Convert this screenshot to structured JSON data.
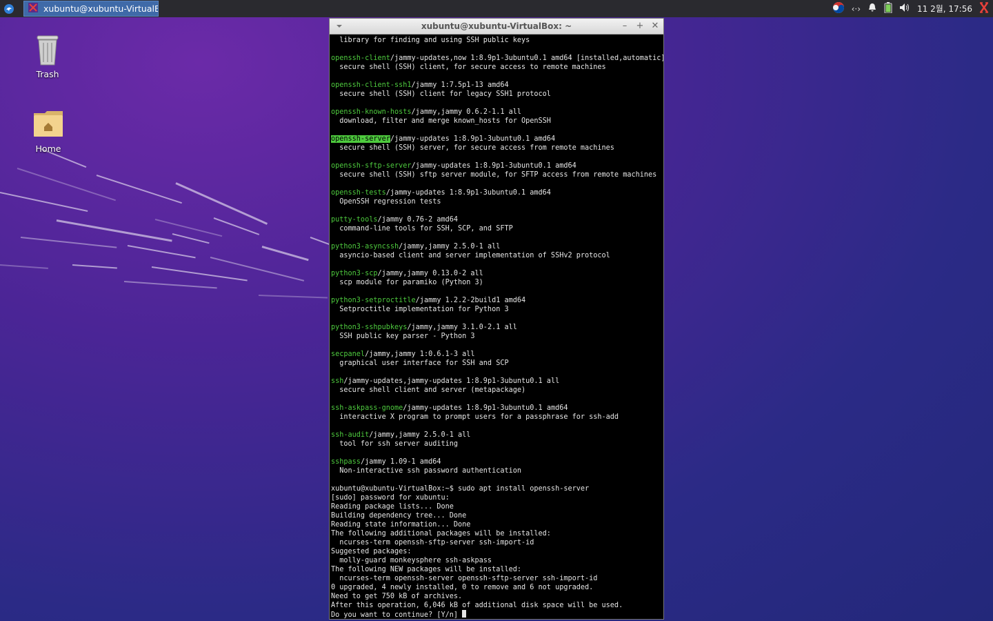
{
  "panel": {
    "task_title": "xubuntu@xubuntu-VirtualBo...",
    "clock": "11 2월, 17:56",
    "tray_icons": [
      "ibus-korean-icon",
      "network-icon",
      "notification-bell-icon",
      "battery-icon",
      "volume-icon",
      "xfce-logo-icon"
    ]
  },
  "desktop": {
    "trash_label": "Trash",
    "home_label": "Home"
  },
  "terminal": {
    "title": "xubuntu@xubuntu-VirtualBox: ~",
    "entries": [
      {
        "pkg": "",
        "rest": "",
        "desc": "  library for finding and using SSH public keys"
      },
      {
        "pkg": "openssh-client",
        "rest": "/jammy-updates,now 1:8.9p1-3ubuntu0.1 amd64 [installed,automatic]",
        "desc": "  secure shell (SSH) client, for secure access to remote machines"
      },
      {
        "pkg": "openssh-client-ssh1",
        "rest": "/jammy 1:7.5p1-13 amd64",
        "desc": "  secure shell (SSH) client for legacy SSH1 protocol"
      },
      {
        "pkg": "openssh-known-hosts",
        "rest": "/jammy,jammy 0.6.2-1.1 all",
        "desc": "  download, filter and merge known_hosts for OpenSSH"
      },
      {
        "pkg": "openssh-server",
        "rest": "/jammy-updates 1:8.9p1-3ubuntu0.1 amd64",
        "desc": "  secure shell (SSH) server, for secure access from remote machines",
        "highlight": true
      },
      {
        "pkg": "openssh-sftp-server",
        "rest": "/jammy-updates 1:8.9p1-3ubuntu0.1 amd64",
        "desc": "  secure shell (SSH) sftp server module, for SFTP access from remote machines"
      },
      {
        "pkg": "openssh-tests",
        "rest": "/jammy-updates 1:8.9p1-3ubuntu0.1 amd64",
        "desc": "  OpenSSH regression tests"
      },
      {
        "pkg": "putty-tools",
        "rest": "/jammy 0.76-2 amd64",
        "desc": "  command-line tools for SSH, SCP, and SFTP"
      },
      {
        "pkg": "python3-asyncssh",
        "rest": "/jammy,jammy 2.5.0-1 all",
        "desc": "  asyncio-based client and server implementation of SSHv2 protocol"
      },
      {
        "pkg": "python3-scp",
        "rest": "/jammy,jammy 0.13.0-2 all",
        "desc": "  scp module for paramiko (Python 3)"
      },
      {
        "pkg": "python3-setproctitle",
        "rest": "/jammy 1.2.2-2build1 amd64",
        "desc": "  Setproctitle implementation for Python 3"
      },
      {
        "pkg": "python3-sshpubkeys",
        "rest": "/jammy,jammy 3.1.0-2.1 all",
        "desc": "  SSH public key parser - Python 3"
      },
      {
        "pkg": "secpanel",
        "rest": "/jammy,jammy 1:0.6.1-3 all",
        "desc": "  graphical user interface for SSH and SCP"
      },
      {
        "pkg": "ssh",
        "rest": "/jammy-updates,jammy-updates 1:8.9p1-3ubuntu0.1 all",
        "desc": "  secure shell client and server (metapackage)"
      },
      {
        "pkg": "ssh-askpass-gnome",
        "rest": "/jammy-updates 1:8.9p1-3ubuntu0.1 amd64",
        "desc": "  interactive X program to prompt users for a passphrase for ssh-add"
      },
      {
        "pkg": "ssh-audit",
        "rest": "/jammy,jammy 2.5.0-1 all",
        "desc": "  tool for ssh server auditing"
      },
      {
        "pkg": "sshpass",
        "rest": "/jammy 1.09-1 amd64",
        "desc": "  Non-interactive ssh password authentication"
      }
    ],
    "output_lines": [
      "xubuntu@xubuntu-VirtualBox:~$ sudo apt install openssh-server",
      "[sudo] password for xubuntu:",
      "Reading package lists... Done",
      "Building dependency tree... Done",
      "Reading state information... Done",
      "The following additional packages will be installed:",
      "  ncurses-term openssh-sftp-server ssh-import-id",
      "Suggested packages:",
      "  molly-guard monkeysphere ssh-askpass",
      "The following NEW packages will be installed:",
      "  ncurses-term openssh-server openssh-sftp-server ssh-import-id",
      "0 upgraded, 4 newly installed, 0 to remove and 6 not upgraded.",
      "Need to get 750 kB of archives.",
      "After this operation, 6,046 kB of additional disk space will be used."
    ],
    "prompt_line": "Do you want to continue? [Y/n] "
  },
  "colors": {
    "package_green": "#4ecb3e",
    "terminal_bg": "#000000",
    "task_button": "#3f6aa8"
  }
}
